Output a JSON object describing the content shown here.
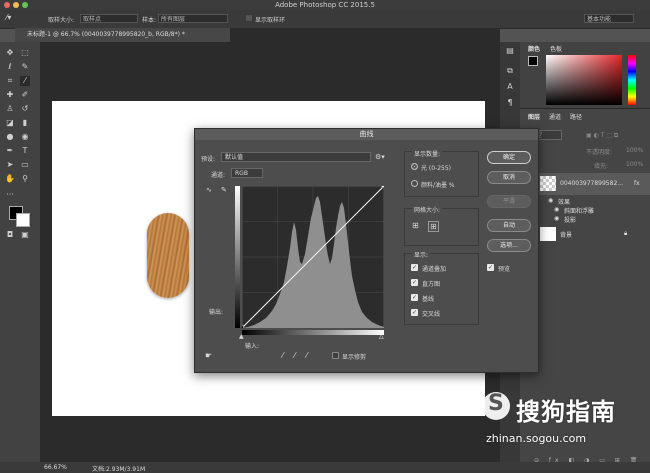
{
  "app": {
    "title": "Adobe Photoshop CC 2015.5",
    "workspace": "基本功能",
    "document_tab": "未标题-1 @ 66.7% (0040039778995820_b, RGB/8*) *",
    "zoom": "66.67%",
    "doc_size": "文档:2.93M/3.91M"
  },
  "options_bar": {
    "sample_size_label": "取样大小:",
    "sample_size_value": "取样点",
    "sample_label": "样本:",
    "sample_value": "所有图层",
    "show_ring": "显示取样环"
  },
  "panels": {
    "color_tab": "颜色",
    "swatches_tab": "色板",
    "layers_tab": "图层",
    "channels_tab": "通道",
    "paths_tab": "路径",
    "kind_label": "类型",
    "opacity_label": "不透明度:",
    "opacity_value": "100%",
    "fill_label": "填充:",
    "fill_value": "100%",
    "layers": [
      {
        "name": "004003977899582...",
        "fx": "fx"
      },
      {
        "name": "效果"
      },
      {
        "name": "斜面和浮雕"
      },
      {
        "name": "投影"
      },
      {
        "name": "背景"
      }
    ]
  },
  "curves": {
    "title": "曲线",
    "preset_label": "预设:",
    "preset_value": "默认值",
    "channel_label": "通道:",
    "channel_value": "RGB",
    "output_label": "输出:",
    "input_label": "输入:",
    "show_clipping": "显示修剪",
    "display_amount_label": "显示数量:",
    "light_option": "光 (0-255)",
    "pigment_option": "颜料/油墨 %",
    "grid_size_label": "网格大小:",
    "show_label": "显示:",
    "show_options": [
      "通道叠加",
      "直方图",
      "基线",
      "交叉线"
    ],
    "buttons": {
      "ok": "确定",
      "cancel": "取消",
      "smooth": "平滑",
      "auto": "自动",
      "options": "选项..."
    },
    "preview": "预览"
  },
  "watermark": {
    "brand": "搜狗指南",
    "url": "zhinan.sogou.com"
  }
}
